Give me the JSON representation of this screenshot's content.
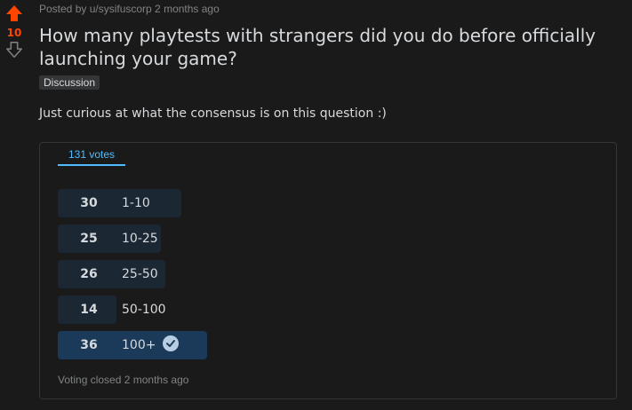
{
  "post": {
    "score": "10",
    "meta": "Posted by u/sysifuscorp 2 months ago",
    "title": "How many playtests with strangers did you do before officially launching your game?",
    "flair": "Discussion",
    "body": "Just curious at what the consensus is on this question :)"
  },
  "poll": {
    "tab_label": "131 votes",
    "options": [
      {
        "count": "30",
        "label": "1-10",
        "fraction": 0.83,
        "selected": false
      },
      {
        "count": "25",
        "label": "10-25",
        "fraction": 0.69,
        "selected": false
      },
      {
        "count": "26",
        "label": "25-50",
        "fraction": 0.72,
        "selected": false
      },
      {
        "count": "14",
        "label": "50-100",
        "fraction": 0.39,
        "selected": false
      },
      {
        "count": "36",
        "label": "100+",
        "fraction": 1.0,
        "selected": true
      }
    ],
    "footer": "Voting closed 2 months ago"
  },
  "colors": {
    "upvote": "#ff4500",
    "tab_accent": "#4fbcff",
    "row_bg": "#1b2733",
    "row_selected_bg": "#1b3a59"
  },
  "icons": {
    "upvote": "upvote-arrow-icon",
    "downvote": "downvote-arrow-icon",
    "selected": "check-circle-icon"
  }
}
